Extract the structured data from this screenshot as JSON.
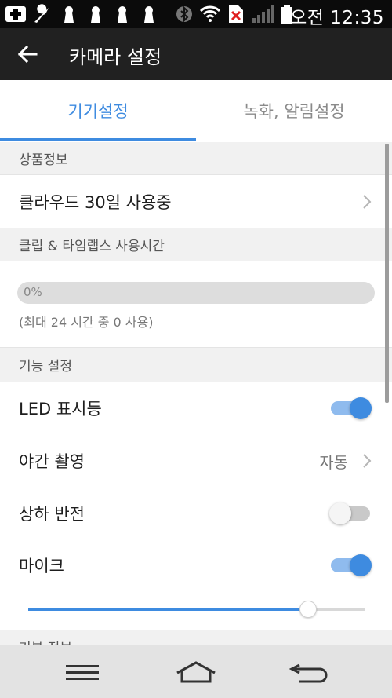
{
  "status_bar": {
    "time": "오전 12:35",
    "icons": [
      "medical-cross-icon",
      "wrench-icon",
      "keyhole-icon",
      "keyhole-icon",
      "keyhole-icon",
      "keyhole-icon",
      "bluetooth-icon",
      "wifi-icon",
      "no-sim-icon",
      "signal-icon",
      "battery-icon"
    ]
  },
  "app_bar": {
    "title": "카메라 설정",
    "back_icon": "arrow-left-icon"
  },
  "tabs": [
    {
      "label": "기기설정",
      "active": true
    },
    {
      "label": "녹화, 알림설정",
      "active": false
    }
  ],
  "product_info": {
    "header": "상품정보",
    "cloud_label": "클라우드 30일 사용중"
  },
  "usage": {
    "header": "클립 & 타임랩스 사용시간",
    "progress_text": "0%",
    "progress_value": 0,
    "note": "(최대 24 시간 중 0 사용)"
  },
  "features": {
    "header": "기능 설정",
    "led_label": "LED 표시등",
    "led_on": true,
    "night_label": "야간 촬영",
    "night_value": "자동",
    "flip_label": "상하 반전",
    "flip_on": false,
    "mic_label": "마이크",
    "mic_on": true,
    "mic_volume": 0.83
  },
  "next_section": {
    "header": "기본 정보"
  },
  "nav": {
    "menu_icon": "menu-icon",
    "home_icon": "home-icon",
    "back_icon": "back-icon"
  },
  "colors": {
    "accent": "#3e8be0",
    "app_bar": "#212121",
    "status_bar": "#0b0b0b"
  }
}
